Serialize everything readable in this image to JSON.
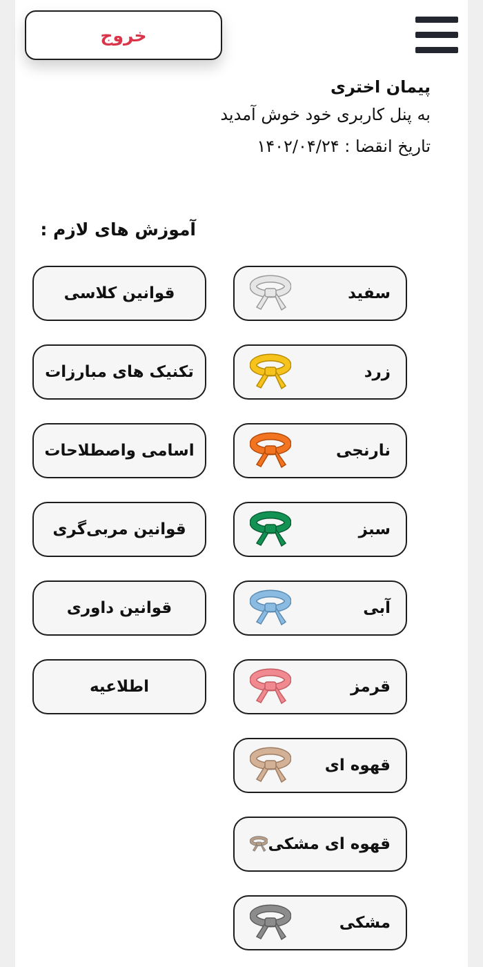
{
  "header": {
    "logout_label": "خروج"
  },
  "user": {
    "name": "پیمان اختری",
    "welcome": "به پنل کاربری خود خوش آمدید",
    "expiry": "تاریخ انقضا : ۱۴۰۲/۰۴/۲۴"
  },
  "section_title": "آموزش های لازم :",
  "belts": [
    {
      "label": "سفید",
      "color": "#e6e6e6",
      "stroke": "#9a9a9a"
    },
    {
      "label": "زرد",
      "color": "#f6c21c",
      "stroke": "#b88a00"
    },
    {
      "label": "نارنجی",
      "color": "#f27421",
      "stroke": "#b34a0a"
    },
    {
      "label": "سبز",
      "color": "#129354",
      "stroke": "#0a5d33"
    },
    {
      "label": "آبی",
      "color": "#8bbbe0",
      "stroke": "#5a8bb4"
    },
    {
      "label": "قرمز",
      "color": "#f08a90",
      "stroke": "#c45c62"
    },
    {
      "label": "قهوه ای",
      "color": "#d3b196",
      "stroke": "#9e7c62"
    },
    {
      "label": "قهوه ای مشکی",
      "color": "#b79c86",
      "stroke": "#6f6f6f"
    },
    {
      "label": "مشکی",
      "color": "#8c8c8c",
      "stroke": "#5c5c5c"
    }
  ],
  "topics": [
    {
      "label": "قوانین کلاسی"
    },
    {
      "label": "تکنیک های مبارزات"
    },
    {
      "label": "اسامی واصطلاحات"
    },
    {
      "label": "قوانین مربی‌گری"
    },
    {
      "label": "قوانین داوری"
    },
    {
      "label": "اطلاعیه"
    }
  ]
}
